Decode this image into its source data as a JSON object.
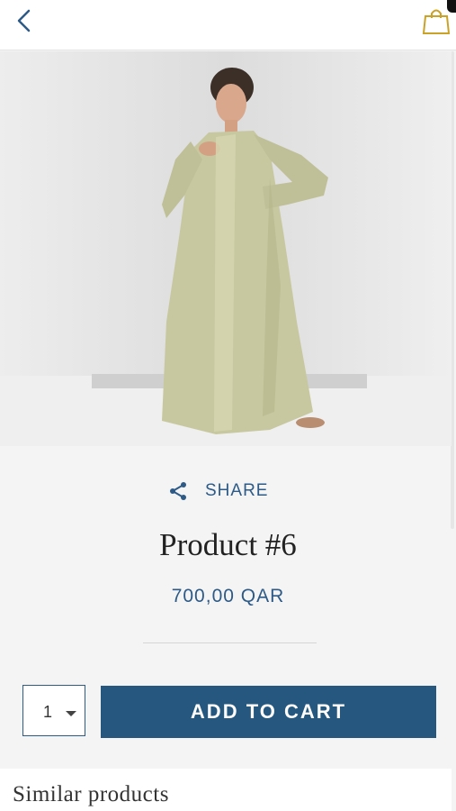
{
  "header": {
    "back_icon": "chevron-left-icon",
    "cart_icon": "shopping-bag-icon"
  },
  "product": {
    "image_alt": "Woman modeling a long sage-green satin abaya",
    "share_label": "SHARE",
    "title": "Product #6",
    "price": "700,00 QAR"
  },
  "purchase": {
    "quantity": "1",
    "add_to_cart_label": "ADD TO CART"
  },
  "similar": {
    "heading": "Similar products"
  },
  "colors": {
    "accent": "#2d5a86",
    "button": "#25577f",
    "cart_icon": "#c9a227",
    "garment": "#c7c8a0"
  }
}
